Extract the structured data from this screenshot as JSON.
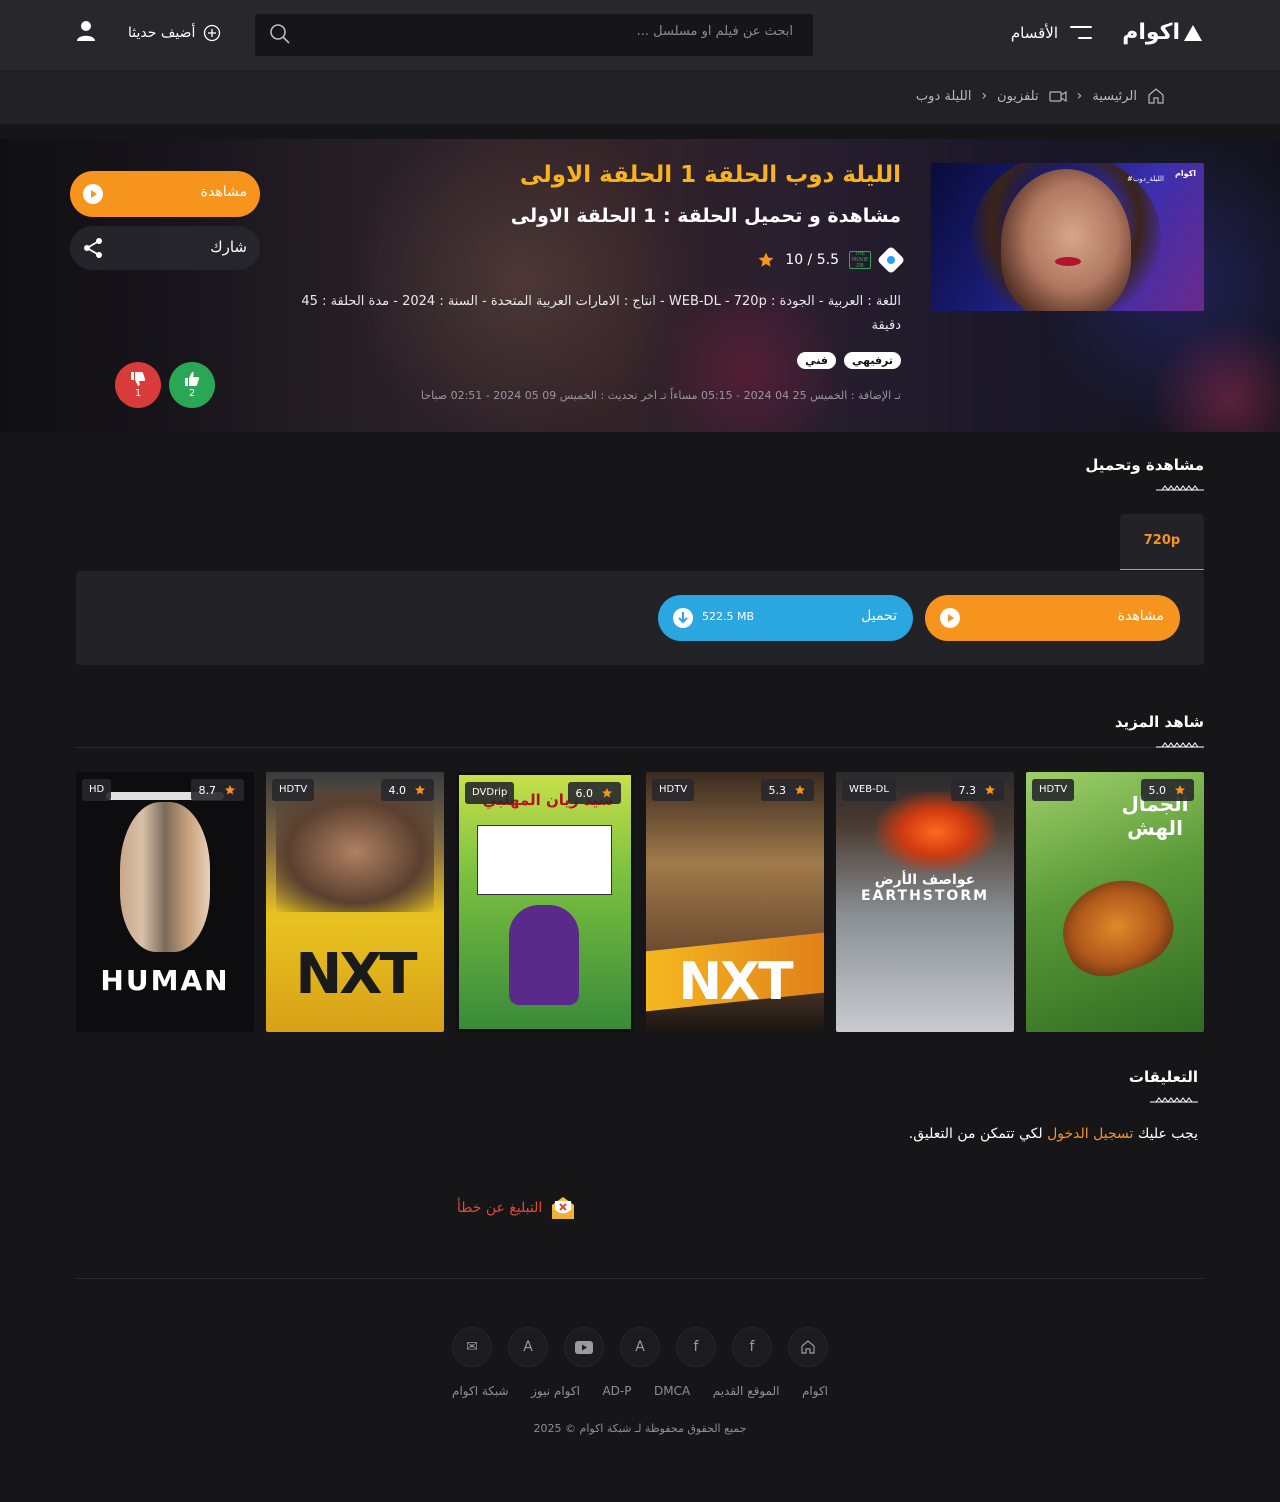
{
  "header": {
    "logo_text": "اكوام",
    "categories_label": "الأقسام",
    "search_placeholder": "ابحث عن فيلم او مسلسل ...",
    "recently_added_label": "أضيف حديثا"
  },
  "breadcrumb": [
    "الرئيسية",
    "تلفزيون",
    "الليلة دوب"
  ],
  "hero": {
    "poster_logo": "اكوام",
    "poster_tag": "#الليلة_دوب",
    "title": "الليلة دوب الحلقة 1 الحلقة الاولى",
    "subtitle": "مشاهدة و تحميل الحلقة : 1 الحلقة الاولى",
    "rating": "5.5 / 10",
    "imdb_badge": "THE MOVIE DB",
    "details": "اللغة : العربية - الجودة : WEB-DL - 720p - انتاج : الامارات العربية المتحدة - السنة : 2024 - مدة الحلقة : 45 دقيقة",
    "genres": [
      "ترفيهي",
      "فني"
    ],
    "dates": "تـ الإضافة : الخميس 25 04 2024 - 05:15 مساءاً تـ اخر تحديث : الخميس 09 05 2024 - 02:51 صباحا",
    "watch_label": "مشاهدة",
    "share_label": "شارك",
    "likes": "2",
    "dislikes": "1"
  },
  "download_section": {
    "title": "مشاهدة وتحميل",
    "quality_tab": "720p",
    "watch_label": "مشاهدة",
    "download_label": "تحميل",
    "file_size": "522.5 MB"
  },
  "more_section": {
    "title": "شاهد المزيد",
    "cards": [
      {
        "rating": "5.0",
        "quality": "HDTV",
        "poster_text": "الجمال الهش",
        "bg": "#6aa34a"
      },
      {
        "rating": "7.3",
        "quality": "WEB-DL",
        "poster_text": "عواصف الأرض EARTHSTORM",
        "bg": "#6d7478"
      },
      {
        "rating": "5.3",
        "quality": "HDTV",
        "poster_text": "NXT",
        "bg": "#8a6a2a"
      },
      {
        "rating": "6.0",
        "quality": "DVDrip",
        "poster_text": "سيد زيان المهلبي",
        "bg": "#4aa33a"
      },
      {
        "rating": "4.0",
        "quality": "HDTV",
        "poster_text": "NXT",
        "bg": "#c89a20"
      },
      {
        "rating": "8.7",
        "quality": "HD",
        "poster_text": "HUMAN",
        "bg": "#111114"
      }
    ]
  },
  "comments": {
    "title": "التعليقات",
    "note_prefix": "يجب عليك",
    "login_link": "تسجيل الدخول",
    "note_suffix": "لكي تتمكن من التعليق."
  },
  "report_label": "التبليغ عن خطأ",
  "footer": {
    "links": [
      "اكوام",
      "الموقع القديم",
      "DMCA",
      "AD-P",
      "اكوام نيوز",
      "شبكة اكوام"
    ],
    "copyright": "جميع الحقوق محفوظة لـ شبكة اكوام © 2025"
  },
  "colors": {
    "accent": "#f7941d",
    "title_yellow": "#f7b21c",
    "download_blue": "#2aa7e0",
    "like_green": "#2aa655",
    "dislike_red": "#d93a3a"
  }
}
